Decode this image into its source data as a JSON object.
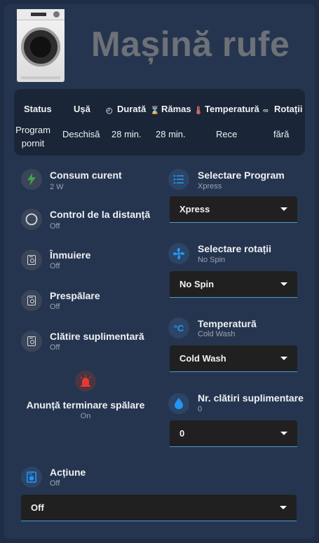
{
  "header": {
    "title": "Mașină rufe",
    "image": "washing-machine-photo"
  },
  "status": {
    "headers": [
      "Status",
      "Ușă",
      "Durată",
      "Rămas",
      "Temperatură",
      "Rotații"
    ],
    "values": [
      "Program pornit",
      "Deschisă",
      "28 min.",
      "28 min.",
      "Rece",
      "fără"
    ]
  },
  "left": {
    "power": {
      "name": "Consum curent",
      "state": "2 W",
      "icon": "lightning-icon",
      "color": "#43a047"
    },
    "remote": {
      "name": "Control de la distanță",
      "state": "Off",
      "icon": "circle-outline-icon"
    },
    "soak": {
      "name": "Înmuiere",
      "state": "Off",
      "icon": "washing-machine-icon"
    },
    "prewash": {
      "name": "Prespălare",
      "state": "Off",
      "icon": "washing-machine-icon"
    },
    "extra_rinse": {
      "name": "Clătire suplimentară",
      "state": "Off",
      "icon": "washing-machine-icon"
    },
    "notify": {
      "name": "Anunță terminare spălare",
      "state": "On",
      "icon": "alarm-light-icon",
      "color": "#e53935"
    }
  },
  "right": {
    "program": {
      "name": "Selectare Program",
      "state": "Xpress",
      "value": "Xpress",
      "icon": "list-icon",
      "color": "#2196f3"
    },
    "spin": {
      "name": "Selectare rotații",
      "state": "No Spin",
      "value": "No Spin",
      "icon": "fan-icon",
      "color": "#2196f3"
    },
    "temp": {
      "name": "Temperatură",
      "state": "Cold Wash",
      "value": "Cold Wash",
      "icon": "celsius-icon",
      "color": "#2196f3"
    },
    "rinses": {
      "name": "Nr. clătiri suplimentare",
      "state": "0",
      "value": "0",
      "icon": "water-drop-icon",
      "color": "#2196f3"
    }
  },
  "action": {
    "name": "Acțiune",
    "state": "Off",
    "value": "Off",
    "icon": "washing-machine-icon",
    "color": "#2196f3"
  }
}
